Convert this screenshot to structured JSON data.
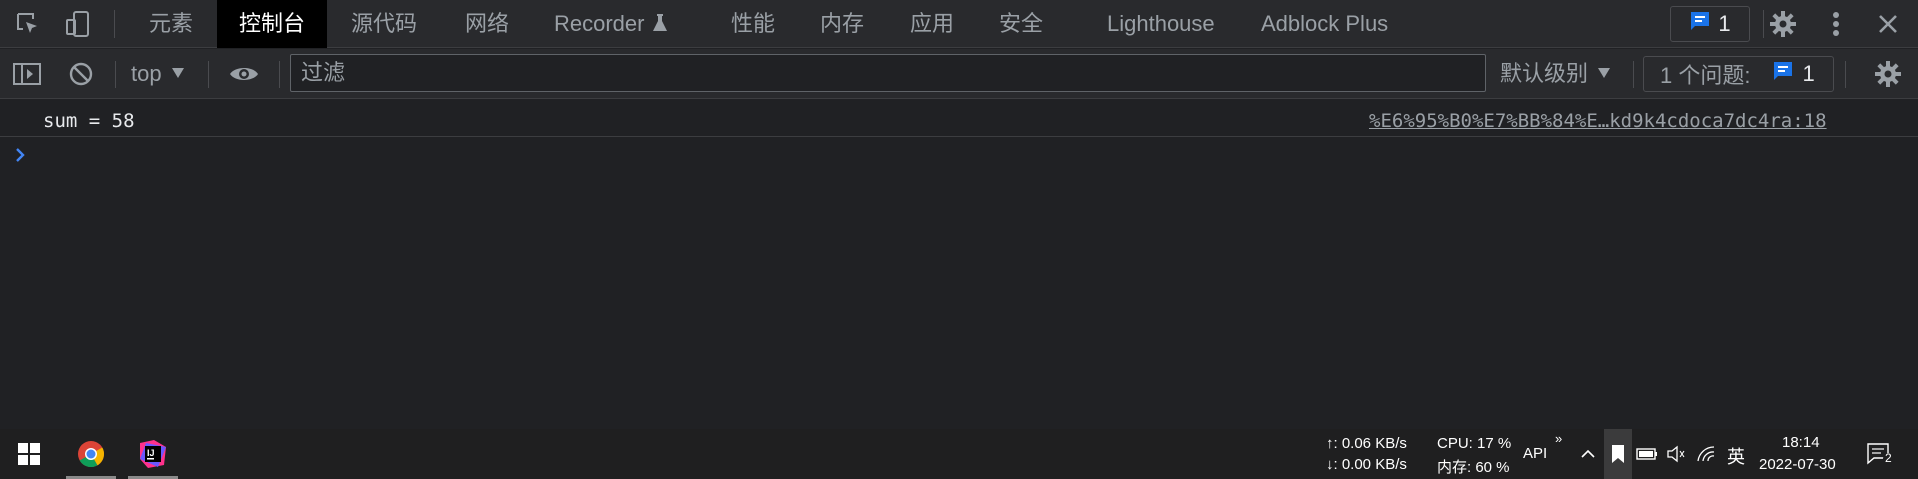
{
  "tabs": [
    {
      "label": "元素"
    },
    {
      "label": "控制台"
    },
    {
      "label": "源代码"
    },
    {
      "label": "网络"
    },
    {
      "label": "Recorder"
    },
    {
      "label": "性能"
    },
    {
      "label": "内存"
    },
    {
      "label": "应用"
    },
    {
      "label": "安全"
    },
    {
      "label": "Lighthouse"
    },
    {
      "label": "Adblock Plus"
    }
  ],
  "active_tab": "控制台",
  "header_issues_count": "1",
  "console_toolbar": {
    "context": "top",
    "filter_placeholder": "过滤",
    "levels_label": "默认级别",
    "issues_label": "1 个问题:",
    "issues_count": "1"
  },
  "console": {
    "messages": [
      {
        "text": "sum = 58",
        "source": "%E6%95%B0%E7%BB%84%E…kd9k4cdoca7dc4ra:18"
      }
    ]
  },
  "taskbar": {
    "net_up": "↑: 0.06 KB/s",
    "net_down": "↓: 0.00 KB/s",
    "cpu": "CPU: 17 %",
    "mem": "内存: 60 %",
    "api": "API",
    "ime": "英",
    "time": "18:14",
    "date": "2022-07-30",
    "notification_count": "2"
  },
  "colors": {
    "accent_blue": "#1a73e8",
    "prompt_blue": "#4285f4",
    "panel_bg": "#202124",
    "toolbar_bg": "#292a2d"
  }
}
